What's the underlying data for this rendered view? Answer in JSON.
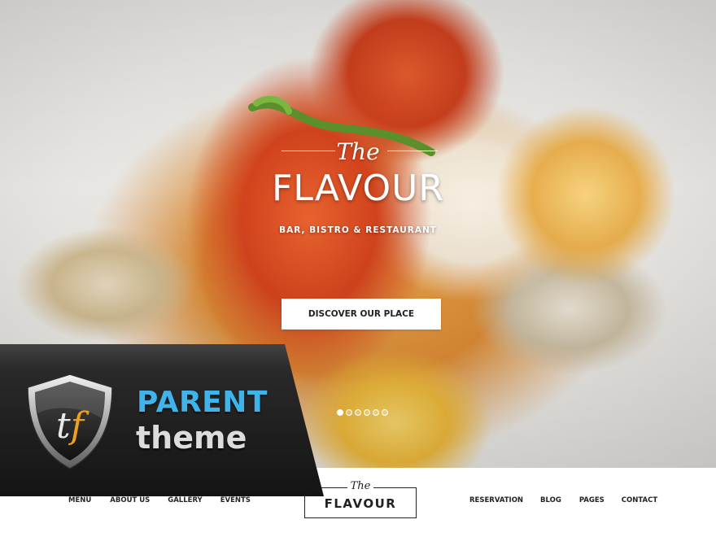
{
  "hero": {
    "logo_the": "The",
    "logo_title": "FLAVOUR",
    "logo_subtitle": "BAR, BISTRO & RESTAURANT",
    "cta_label": "DISCOVER OUR PLACE",
    "slider": {
      "total_slides": 6,
      "active_index": 0
    }
  },
  "banner": {
    "badge_letters": "tf",
    "parent_label": "PARENT",
    "theme_label": "theme"
  },
  "nav": {
    "left_items": [
      "MENU",
      "ABOUT US",
      "GALLERY",
      "EVENTS"
    ],
    "right_items": [
      "RESERVATION",
      "BLOG",
      "PAGES",
      "CONTACT"
    ],
    "logo_the": "The",
    "logo_title": "FLAVOUR"
  },
  "colors": {
    "accent_blue": "#3fb4ea",
    "banner_dark": "#1e1e1e",
    "text_dark": "#222222"
  }
}
